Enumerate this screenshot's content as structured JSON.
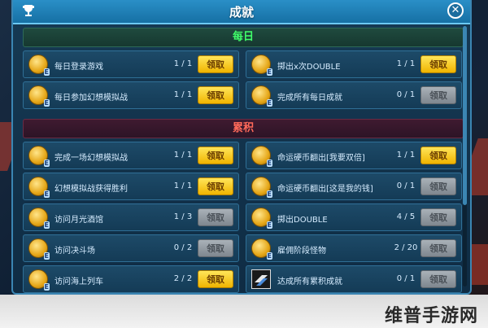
{
  "window": {
    "title": "成就"
  },
  "sections": {
    "daily": "每日",
    "accumulated": "累积"
  },
  "left_daily": [
    {
      "name": "每日登录游戏",
      "progress": "1 / 1",
      "button": "领取",
      "enabled": true,
      "icon": "coin-icon"
    },
    {
      "name": "每日参加幻想模拟战",
      "progress": "1 / 1",
      "button": "领取",
      "enabled": true,
      "icon": "coin-icon"
    }
  ],
  "right_daily": [
    {
      "name": "掷出x次DOUBLE",
      "progress": "1 / 1",
      "button": "领取",
      "enabled": true,
      "icon": "coin-icon"
    },
    {
      "name": "完成所有每日成就",
      "progress": "0 / 1",
      "button": "领取",
      "enabled": false,
      "icon": "coin-icon"
    }
  ],
  "left_acc": [
    {
      "name": "完成一场幻想模拟战",
      "progress": "1 / 1",
      "button": "领取",
      "enabled": true,
      "icon": "coin-icon"
    },
    {
      "name": "幻想模拟战获得胜利",
      "progress": "1 / 1",
      "button": "领取",
      "enabled": true,
      "icon": "coin-icon"
    },
    {
      "name": "访问月光酒馆",
      "progress": "1 / 3",
      "button": "领取",
      "enabled": false,
      "icon": "coin-icon"
    },
    {
      "name": "访问决斗场",
      "progress": "0 / 2",
      "button": "领取",
      "enabled": false,
      "icon": "coin-icon"
    },
    {
      "name": "访问海上列车",
      "progress": "2 / 2",
      "button": "领取",
      "enabled": true,
      "icon": "coin-icon"
    }
  ],
  "right_acc": [
    {
      "name": "命运硬币翻出[我要双倍]",
      "progress": "1 / 1",
      "button": "领取",
      "enabled": true,
      "icon": "coin-icon"
    },
    {
      "name": "命运硬币翻出[这是我的钱]",
      "progress": "0 / 1",
      "button": "领取",
      "enabled": false,
      "icon": "coin-icon"
    },
    {
      "name": "掷出DOUBLE",
      "progress": "4 / 5",
      "button": "领取",
      "enabled": false,
      "icon": "coin-icon"
    },
    {
      "name": "雇佣阶段怪物",
      "progress": "2 / 20",
      "button": "领取",
      "enabled": false,
      "icon": "coin-icon"
    },
    {
      "name": "达成所有累积成就",
      "progress": "0 / 1",
      "button": "领取",
      "enabled": false,
      "icon": "special-card-icon"
    }
  ],
  "coin_badge": "E",
  "watermark": "维普手游网",
  "colors": {
    "accent": "#2a8fc7",
    "button_on": "#f0b400",
    "button_off": "#7f878f",
    "daily": "#40ff6a",
    "accumulated": "#ff6a5a"
  }
}
